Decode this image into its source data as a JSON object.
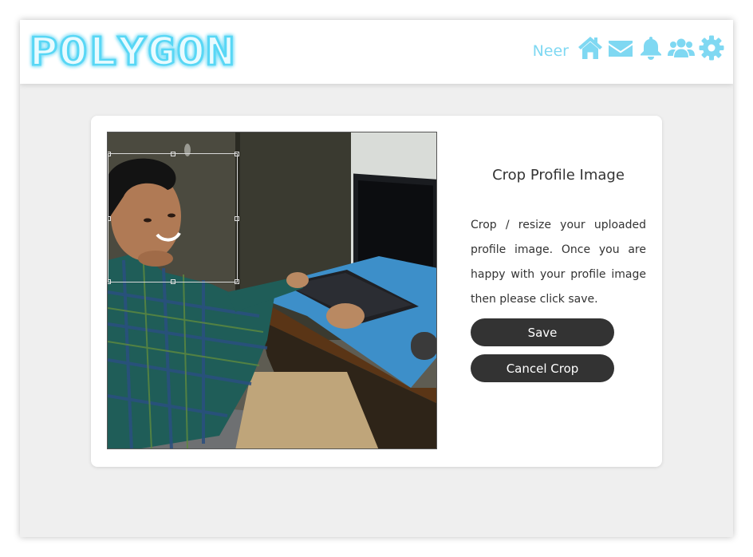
{
  "header": {
    "logo_text": "POLYGON",
    "username": "Neer",
    "icons": [
      "home-icon",
      "envelope-icon",
      "bell-icon",
      "users-icon",
      "gear-icon"
    ],
    "accent_color": "#7fd8f2"
  },
  "crop_panel": {
    "title": "Crop Profile Image",
    "description": "Crop / resize your uploaded profile image. Once you are happy with your profile image then please click save.",
    "save_label": "Save",
    "cancel_label": "Cancel Crop"
  },
  "colors": {
    "background": "#efefef",
    "card": "#ffffff",
    "button": "#333333",
    "button_text": "#ffffff"
  }
}
